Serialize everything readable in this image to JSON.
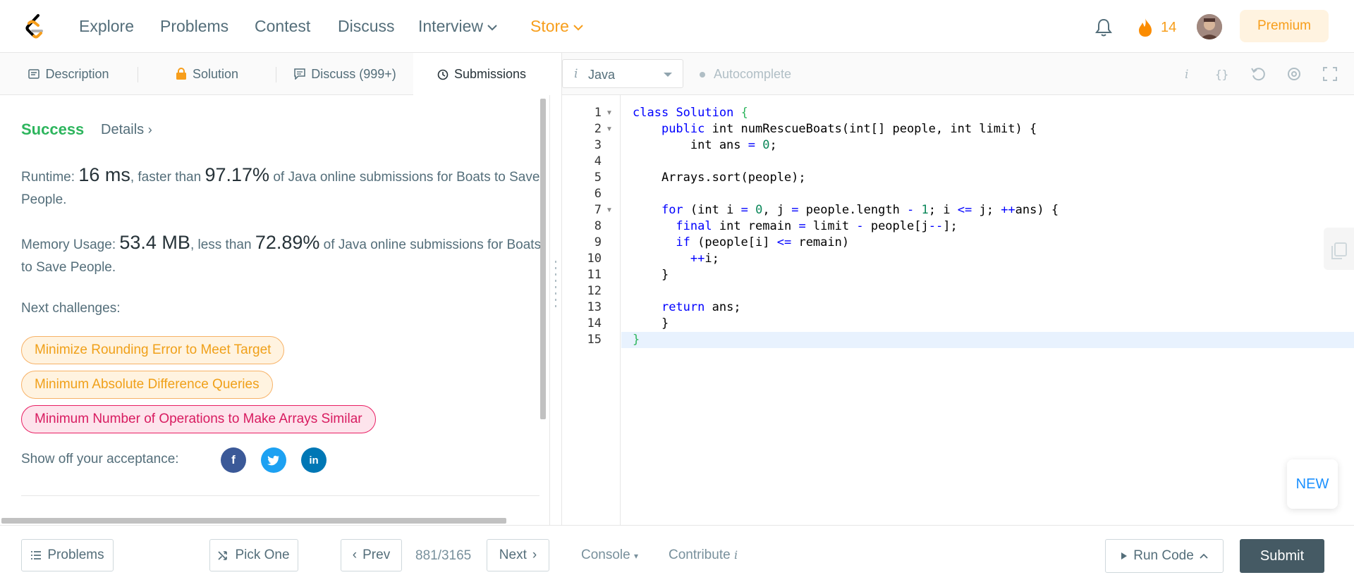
{
  "nav": {
    "links": [
      "Explore",
      "Problems",
      "Contest",
      "Discuss",
      "Interview",
      "Store"
    ],
    "streak": "14",
    "premium": "Premium",
    "accent_color": "#f79e1b"
  },
  "tabs": [
    {
      "label": "Description",
      "icon": "description-icon"
    },
    {
      "label": "Solution",
      "icon": "lock-icon"
    },
    {
      "label": "Discuss (999+)",
      "icon": "discuss-icon"
    },
    {
      "label": "Submissions",
      "icon": "clock-icon",
      "active": true
    }
  ],
  "result": {
    "status": "Success",
    "details": "Details",
    "runtime_label": "Runtime: ",
    "runtime_value": "16 ms",
    "runtime_mid": ", faster than ",
    "runtime_pct": "97.17%",
    "runtime_tail": " of Java online submissions for Boats to Save People.",
    "memory_label": "Memory Usage: ",
    "memory_value": "53.4 MB",
    "memory_mid": ", less than ",
    "memory_pct": "72.89%",
    "memory_tail": " of Java online submissions for Boats to Save People.",
    "next_label": "Next challenges:",
    "challenges": [
      {
        "title": "Minimize Rounding Error to Meet Target",
        "difficulty": "medium"
      },
      {
        "title": "Minimum Absolute Difference Queries",
        "difficulty": "medium"
      },
      {
        "title": "Minimum Number of Operations to Make Arrays Similar",
        "difficulty": "hard"
      }
    ],
    "share_label": "Show off your acceptance:"
  },
  "editor": {
    "language": "Java",
    "autocomplete": "Autocomplete",
    "line_numbers": [
      "1",
      "2",
      "3",
      "4",
      "5",
      "6",
      "7",
      "8",
      "9",
      "10",
      "11",
      "12",
      "13",
      "14",
      "15"
    ],
    "current_line": 15,
    "new_badge": "NEW"
  },
  "bottom": {
    "problems": "Problems",
    "pick_one": "Pick One",
    "prev": "Prev",
    "pager": "881/3165",
    "next": "Next",
    "console": "Console",
    "contribute": "Contribute",
    "run_code": "Run Code",
    "submit": "Submit"
  }
}
